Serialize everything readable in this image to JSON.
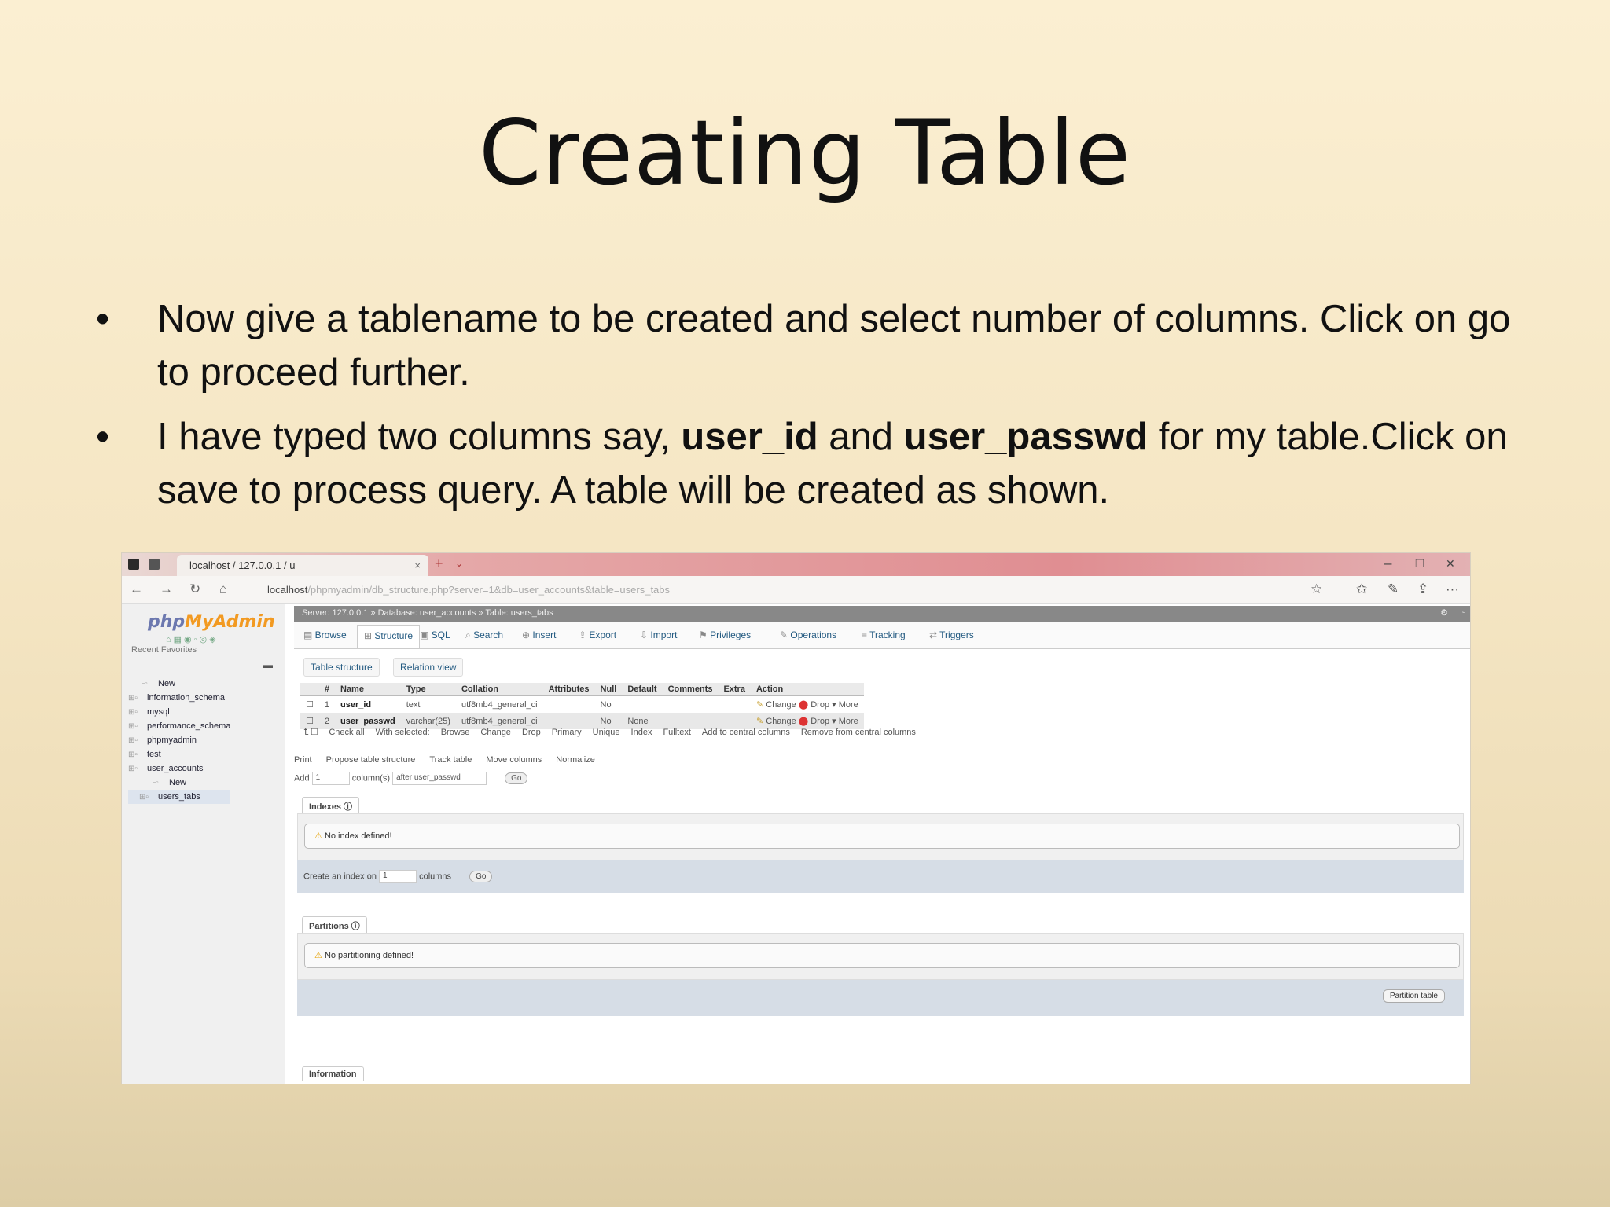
{
  "slide": {
    "title": "Creating Table",
    "bullets": [
      {
        "text": "Now give a tablename to be created and select number of columns. Click on go to proceed further."
      },
      {
        "pre": "I have typed two columns say, ",
        "b1": "user_id",
        "mid": " and ",
        "b2": "user_passwd",
        "post": " for my table.Click on save to process query. A table will be created as shown."
      }
    ]
  },
  "screenshot": {
    "browser": {
      "tab_title": "localhost / 127.0.0.1 / u",
      "tab_close": "×",
      "new_tab": "+",
      "tab_dropdown": "⌄",
      "url_host": "localhost",
      "url_path": "/phpmyadmin/db_structure.php?server=1&db=user_accounts&table=users_tabs",
      "controls": {
        "minimize": "–",
        "maximize": "❐",
        "close": "✕"
      },
      "nav": {
        "back": "←",
        "forward": "→",
        "reload": "↻",
        "home": "⌂"
      },
      "toolbar": {
        "star": "☆",
        "favs": "✩",
        "pen": "✎",
        "share": "⇪",
        "more": "···"
      }
    },
    "sidebar": {
      "logo_php": "php",
      "logo_myadmin": "MyAdmin",
      "icons": "⌂▦◉◦◎◈",
      "tabs": "Recent  Favorites",
      "collapse": "▬",
      "tree": [
        {
          "label": "New",
          "indent": 1
        },
        {
          "label": "information_schema",
          "indent": 0
        },
        {
          "label": "mysql",
          "indent": 0
        },
        {
          "label": "performance_schema",
          "indent": 0
        },
        {
          "label": "phpmyadmin",
          "indent": 0
        },
        {
          "label": "test",
          "indent": 0
        },
        {
          "label": "user_accounts",
          "indent": 0
        },
        {
          "label": "New",
          "indent": 2
        },
        {
          "label": "users_tabs",
          "indent": 1
        }
      ]
    },
    "breadcrumb": "Server: 127.0.0.1 » Database: user_accounts » Table: users_tabs",
    "crumb_gear": "⚙",
    "crumb_close": "▫",
    "menu": [
      "Browse",
      "Structure",
      "SQL",
      "Search",
      "Insert",
      "Export",
      "Import",
      "Privileges",
      "Operations",
      "Tracking",
      "Triggers"
    ],
    "subtabs": [
      "Table structure",
      "Relation view"
    ],
    "structure": {
      "headers": [
        "#",
        "Name",
        "Type",
        "Collation",
        "Attributes",
        "Null",
        "Default",
        "Comments",
        "Extra",
        "Action"
      ],
      "rows": [
        {
          "num": "1",
          "name": "user_id",
          "type": "text",
          "collation": "utf8mb4_general_ci",
          "attributes": "",
          "null": "No",
          "default": "",
          "comments": "",
          "extra": ""
        },
        {
          "num": "2",
          "name": "user_passwd",
          "type": "varchar(25)",
          "collation": "utf8mb4_general_ci",
          "attributes": "",
          "null": "No",
          "default": "None",
          "comments": "",
          "extra": ""
        }
      ],
      "action_change": "Change",
      "action_drop": "Drop",
      "action_more": "More"
    },
    "with_selected": [
      "Check all",
      "With selected:",
      "Browse",
      "Change",
      "Drop",
      "Primary",
      "Unique",
      "Index",
      "Fulltext",
      "Add to central columns",
      "Remove from central columns"
    ],
    "print_row": [
      "Print",
      "Propose table structure",
      "Track table",
      "Move columns",
      "Normalize"
    ],
    "add_row": {
      "label": "Add",
      "count": "1",
      "columns": "column(s)",
      "position": "after user_passwd",
      "go": "Go"
    },
    "indexes": {
      "label": "Indexes",
      "notice": "No index defined!",
      "create_label": "Create an index on",
      "count": "1",
      "columns": "columns",
      "go": "Go"
    },
    "partitions": {
      "label": "Partitions",
      "notice": "No partitioning defined!",
      "button": "Partition table"
    },
    "information_label": "Information"
  },
  "colors": {
    "accent": "#235a81",
    "tabbar": "#e08e92",
    "logo_php": "#6c78af",
    "logo_myadmin": "#f29a22"
  }
}
